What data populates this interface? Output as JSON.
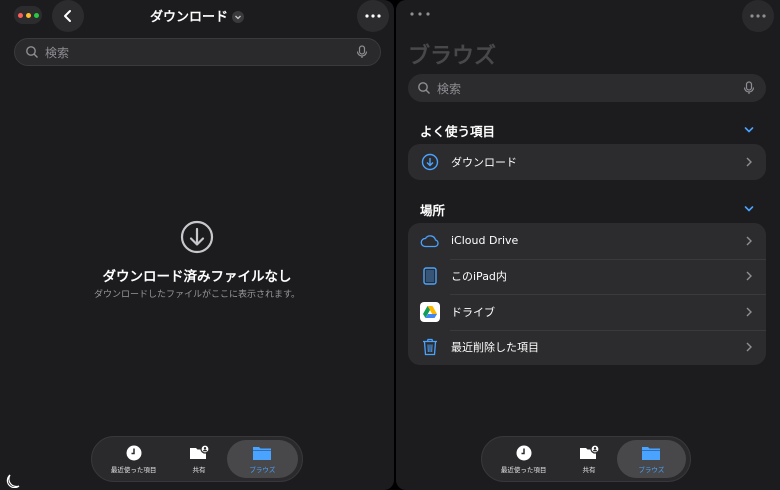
{
  "left": {
    "title": "ダウンロード",
    "search_placeholder": "検索",
    "empty_title": "ダウンロード済みファイルなし",
    "empty_subtitle": "ダウンロードしたファイルがここに表示されます。"
  },
  "right": {
    "title": "ブラウズ",
    "search_placeholder": "検索",
    "favorites_header": "よく使う項目",
    "favorites": [
      {
        "label": "ダウンロード",
        "icon": "download-circle-icon"
      }
    ],
    "locations_header": "場所",
    "locations": [
      {
        "label": "iCloud Drive",
        "icon": "cloud-icon"
      },
      {
        "label": "このiPad内",
        "icon": "ipad-icon"
      },
      {
        "label": "ドライブ",
        "icon": "google-drive-icon"
      },
      {
        "label": "最近削除した項目",
        "icon": "trash-icon"
      }
    ]
  },
  "tabs": [
    {
      "label": "最近使った項目",
      "icon": "clock-icon"
    },
    {
      "label": "共有",
      "icon": "shared-folder-icon"
    },
    {
      "label": "ブラウズ",
      "icon": "folder-icon",
      "active": true
    }
  ],
  "colors": {
    "accent": "#4aa3ff",
    "background": "#1c1c1e",
    "row_background": "#2c2c2e"
  }
}
